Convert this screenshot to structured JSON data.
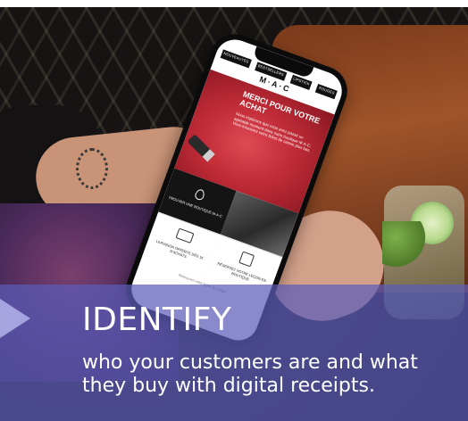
{
  "banner": {
    "headline": "IDENTIFY",
    "subline": "who your customers are and what they buy with digital receipts."
  },
  "phone_screen": {
    "nav": [
      "NOUVEAUTÉS",
      "BESTSELLERS",
      "LIPSTICK",
      "MAQUILLAGE",
      "ROUGES"
    ],
    "logo": "M·A·C",
    "hero_title": "MERCI POUR VOTRE ACHAT",
    "hero_text": "Nous espérons que vous avez passé un agréable moment dans notre boutique M·A·C. Vous trouverez votre ticket de caisse plus bas.",
    "tiles": [
      {
        "label": "TROUVER UNE BOUTIQUE M·A·C"
      },
      {
        "label": ""
      },
      {
        "label": "LIVRAISON OFFERTE DÈS 1€ D'ACHATS"
      },
      {
        "label": "RÉSERVEZ VOTRE LEÇON EN BOUTIQUE"
      }
    ],
    "footer": "Retrouvez votre ticket de caisse"
  },
  "colors": {
    "overlay": "#5c5cb8",
    "accent_red": "#c22c38",
    "text": "#ffffff"
  }
}
